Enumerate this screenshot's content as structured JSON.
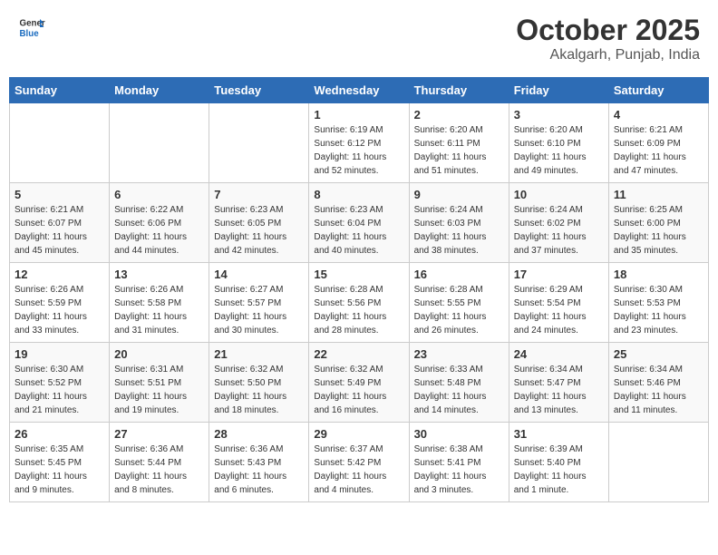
{
  "header": {
    "logo_line1": "General",
    "logo_line2": "Blue",
    "month": "October 2025",
    "location": "Akalgarh, Punjab, India"
  },
  "weekdays": [
    "Sunday",
    "Monday",
    "Tuesday",
    "Wednesday",
    "Thursday",
    "Friday",
    "Saturday"
  ],
  "weeks": [
    [
      {
        "day": "",
        "sunrise": "",
        "sunset": "",
        "daylight": ""
      },
      {
        "day": "",
        "sunrise": "",
        "sunset": "",
        "daylight": ""
      },
      {
        "day": "",
        "sunrise": "",
        "sunset": "",
        "daylight": ""
      },
      {
        "day": "1",
        "sunrise": "Sunrise: 6:19 AM",
        "sunset": "Sunset: 6:12 PM",
        "daylight": "Daylight: 11 hours and 52 minutes."
      },
      {
        "day": "2",
        "sunrise": "Sunrise: 6:20 AM",
        "sunset": "Sunset: 6:11 PM",
        "daylight": "Daylight: 11 hours and 51 minutes."
      },
      {
        "day": "3",
        "sunrise": "Sunrise: 6:20 AM",
        "sunset": "Sunset: 6:10 PM",
        "daylight": "Daylight: 11 hours and 49 minutes."
      },
      {
        "day": "4",
        "sunrise": "Sunrise: 6:21 AM",
        "sunset": "Sunset: 6:09 PM",
        "daylight": "Daylight: 11 hours and 47 minutes."
      }
    ],
    [
      {
        "day": "5",
        "sunrise": "Sunrise: 6:21 AM",
        "sunset": "Sunset: 6:07 PM",
        "daylight": "Daylight: 11 hours and 45 minutes."
      },
      {
        "day": "6",
        "sunrise": "Sunrise: 6:22 AM",
        "sunset": "Sunset: 6:06 PM",
        "daylight": "Daylight: 11 hours and 44 minutes."
      },
      {
        "day": "7",
        "sunrise": "Sunrise: 6:23 AM",
        "sunset": "Sunset: 6:05 PM",
        "daylight": "Daylight: 11 hours and 42 minutes."
      },
      {
        "day": "8",
        "sunrise": "Sunrise: 6:23 AM",
        "sunset": "Sunset: 6:04 PM",
        "daylight": "Daylight: 11 hours and 40 minutes."
      },
      {
        "day": "9",
        "sunrise": "Sunrise: 6:24 AM",
        "sunset": "Sunset: 6:03 PM",
        "daylight": "Daylight: 11 hours and 38 minutes."
      },
      {
        "day": "10",
        "sunrise": "Sunrise: 6:24 AM",
        "sunset": "Sunset: 6:02 PM",
        "daylight": "Daylight: 11 hours and 37 minutes."
      },
      {
        "day": "11",
        "sunrise": "Sunrise: 6:25 AM",
        "sunset": "Sunset: 6:00 PM",
        "daylight": "Daylight: 11 hours and 35 minutes."
      }
    ],
    [
      {
        "day": "12",
        "sunrise": "Sunrise: 6:26 AM",
        "sunset": "Sunset: 5:59 PM",
        "daylight": "Daylight: 11 hours and 33 minutes."
      },
      {
        "day": "13",
        "sunrise": "Sunrise: 6:26 AM",
        "sunset": "Sunset: 5:58 PM",
        "daylight": "Daylight: 11 hours and 31 minutes."
      },
      {
        "day": "14",
        "sunrise": "Sunrise: 6:27 AM",
        "sunset": "Sunset: 5:57 PM",
        "daylight": "Daylight: 11 hours and 30 minutes."
      },
      {
        "day": "15",
        "sunrise": "Sunrise: 6:28 AM",
        "sunset": "Sunset: 5:56 PM",
        "daylight": "Daylight: 11 hours and 28 minutes."
      },
      {
        "day": "16",
        "sunrise": "Sunrise: 6:28 AM",
        "sunset": "Sunset: 5:55 PM",
        "daylight": "Daylight: 11 hours and 26 minutes."
      },
      {
        "day": "17",
        "sunrise": "Sunrise: 6:29 AM",
        "sunset": "Sunset: 5:54 PM",
        "daylight": "Daylight: 11 hours and 24 minutes."
      },
      {
        "day": "18",
        "sunrise": "Sunrise: 6:30 AM",
        "sunset": "Sunset: 5:53 PM",
        "daylight": "Daylight: 11 hours and 23 minutes."
      }
    ],
    [
      {
        "day": "19",
        "sunrise": "Sunrise: 6:30 AM",
        "sunset": "Sunset: 5:52 PM",
        "daylight": "Daylight: 11 hours and 21 minutes."
      },
      {
        "day": "20",
        "sunrise": "Sunrise: 6:31 AM",
        "sunset": "Sunset: 5:51 PM",
        "daylight": "Daylight: 11 hours and 19 minutes."
      },
      {
        "day": "21",
        "sunrise": "Sunrise: 6:32 AM",
        "sunset": "Sunset: 5:50 PM",
        "daylight": "Daylight: 11 hours and 18 minutes."
      },
      {
        "day": "22",
        "sunrise": "Sunrise: 6:32 AM",
        "sunset": "Sunset: 5:49 PM",
        "daylight": "Daylight: 11 hours and 16 minutes."
      },
      {
        "day": "23",
        "sunrise": "Sunrise: 6:33 AM",
        "sunset": "Sunset: 5:48 PM",
        "daylight": "Daylight: 11 hours and 14 minutes."
      },
      {
        "day": "24",
        "sunrise": "Sunrise: 6:34 AM",
        "sunset": "Sunset: 5:47 PM",
        "daylight": "Daylight: 11 hours and 13 minutes."
      },
      {
        "day": "25",
        "sunrise": "Sunrise: 6:34 AM",
        "sunset": "Sunset: 5:46 PM",
        "daylight": "Daylight: 11 hours and 11 minutes."
      }
    ],
    [
      {
        "day": "26",
        "sunrise": "Sunrise: 6:35 AM",
        "sunset": "Sunset: 5:45 PM",
        "daylight": "Daylight: 11 hours and 9 minutes."
      },
      {
        "day": "27",
        "sunrise": "Sunrise: 6:36 AM",
        "sunset": "Sunset: 5:44 PM",
        "daylight": "Daylight: 11 hours and 8 minutes."
      },
      {
        "day": "28",
        "sunrise": "Sunrise: 6:36 AM",
        "sunset": "Sunset: 5:43 PM",
        "daylight": "Daylight: 11 hours and 6 minutes."
      },
      {
        "day": "29",
        "sunrise": "Sunrise: 6:37 AM",
        "sunset": "Sunset: 5:42 PM",
        "daylight": "Daylight: 11 hours and 4 minutes."
      },
      {
        "day": "30",
        "sunrise": "Sunrise: 6:38 AM",
        "sunset": "Sunset: 5:41 PM",
        "daylight": "Daylight: 11 hours and 3 minutes."
      },
      {
        "day": "31",
        "sunrise": "Sunrise: 6:39 AM",
        "sunset": "Sunset: 5:40 PM",
        "daylight": "Daylight: 11 hours and 1 minute."
      },
      {
        "day": "",
        "sunrise": "",
        "sunset": "",
        "daylight": ""
      }
    ]
  ]
}
